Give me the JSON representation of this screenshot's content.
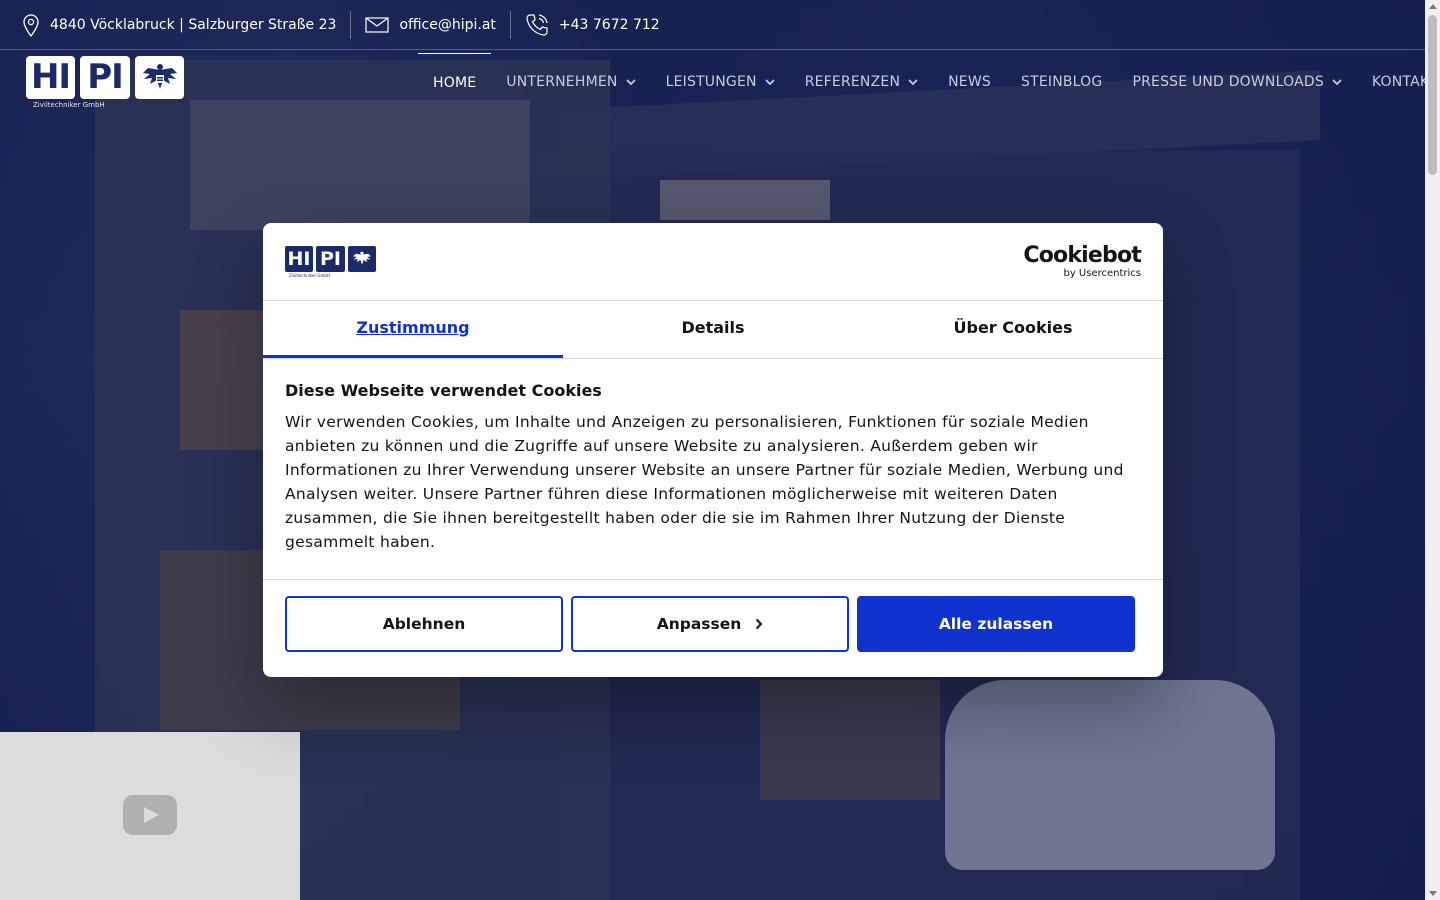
{
  "topbar": {
    "address": "4840 Vöcklabruck | Salzburger Straße 23",
    "email": "office@hipi.at",
    "phone": "+43 7672 712"
  },
  "logo": {
    "part1": "HI",
    "part2": "PI",
    "subtitle": "Ziviltechniker GmbH"
  },
  "nav": {
    "items": [
      {
        "label": "HOME",
        "active": true,
        "dropdown": false
      },
      {
        "label": "UNTERNEHMEN",
        "dropdown": true
      },
      {
        "label": "LEISTUNGEN",
        "dropdown": true
      },
      {
        "label": "REFERENZEN",
        "dropdown": true
      },
      {
        "label": "NEWS",
        "dropdown": false
      },
      {
        "label": "STEINBLOG",
        "dropdown": false
      },
      {
        "label": "PRESSE UND DOWNLOADS",
        "dropdown": true
      },
      {
        "label": "KONTAKT",
        "dropdown": false
      }
    ]
  },
  "cookie_dialog": {
    "brand_main": "Cookiebot",
    "brand_sub": "by Usercentrics",
    "tabs": [
      "Zustimmung",
      "Details",
      "Über Cookies"
    ],
    "active_tab": "Zustimmung",
    "heading": "Diese Webseite verwendet Cookies",
    "text": "Wir verwenden Cookies, um Inhalte und Anzeigen zu personalisieren, Funktionen für soziale Medien anbieten zu können und die Zugriffe auf unsere Website zu analysieren. Außerdem geben wir Informationen zu Ihrer Verwendung unserer Website an unsere Partner für soziale Medien, Werbung und Analysen weiter. Unsere Partner führen diese Informationen möglicherweise mit weiteren Daten zusammen, die Sie ihnen bereitgestellt haben oder die sie im Rahmen Ihrer Nutzung der Dienste gesammelt haben.",
    "buttons": {
      "decline": "Ablehnen",
      "customize": "Anpassen",
      "accept_all": "Alle zulassen"
    }
  },
  "colors": {
    "brand_navy": "#1b2a6b",
    "accent_blue": "#1032cf"
  },
  "icons": [
    "map-pin-icon",
    "mail-icon",
    "phone-icon",
    "eagle-icon",
    "chevron-down-icon",
    "chevron-right-icon",
    "youtube-play-icon"
  ]
}
